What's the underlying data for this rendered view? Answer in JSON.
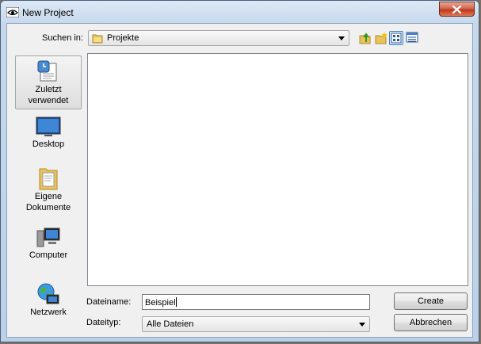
{
  "window": {
    "title": "New Project"
  },
  "lookin": {
    "label": "Suchen in:",
    "value": "Projekte"
  },
  "places": [
    {
      "label_line1": "Zuletzt",
      "label_line2": "verwendet"
    },
    {
      "label_line1": "Desktop",
      "label_line2": ""
    },
    {
      "label_line1": "Eigene",
      "label_line2": "Dokumente"
    },
    {
      "label_line1": "Computer",
      "label_line2": ""
    },
    {
      "label_line1": "Netzwerk",
      "label_line2": ""
    }
  ],
  "filename": {
    "label": "Dateiname:",
    "value": "Beispiel"
  },
  "filetype": {
    "label": "Dateityp:",
    "value": "Alle Dateien"
  },
  "buttons": {
    "create": "Create",
    "cancel": "Abbrechen"
  },
  "icons": {
    "up": "folder-up-icon",
    "newfolder": "new-folder-icon",
    "list": "list-view-icon",
    "details": "details-view-icon"
  }
}
